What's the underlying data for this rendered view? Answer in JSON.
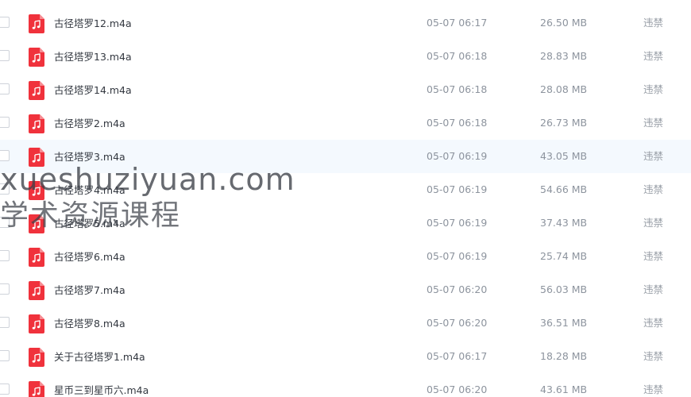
{
  "file_list": {
    "icon": "music-file-icon",
    "icon_color": "#f0323c",
    "hover_background": "#f4f9fe",
    "rows": [
      {
        "name": "古径塔罗12.m4a",
        "time": "05-07 06:17",
        "size": "26.50 MB",
        "status": "违禁"
      },
      {
        "name": "古径塔罗13.m4a",
        "time": "05-07 06:18",
        "size": "28.83 MB",
        "status": "违禁"
      },
      {
        "name": "古径塔罗14.m4a",
        "time": "05-07 06:18",
        "size": "28.08 MB",
        "status": "违禁"
      },
      {
        "name": "古径塔罗2.m4a",
        "time": "05-07 06:18",
        "size": "26.73 MB",
        "status": "违禁"
      },
      {
        "name": "古径塔罗3.m4a",
        "time": "05-07 06:19",
        "size": "43.05 MB",
        "status": "违禁"
      },
      {
        "name": "古径塔罗4.m4a",
        "time": "05-07 06:19",
        "size": "54.66 MB",
        "status": "违禁"
      },
      {
        "name": "古径塔罗5.m4a",
        "time": "05-07 06:19",
        "size": "37.43 MB",
        "status": "违禁"
      },
      {
        "name": "古径塔罗6.m4a",
        "time": "05-07 06:19",
        "size": "25.74 MB",
        "status": "违禁"
      },
      {
        "name": "古径塔罗7.m4a",
        "time": "05-07 06:20",
        "size": "56.03 MB",
        "status": "违禁"
      },
      {
        "name": "古径塔罗8.m4a",
        "time": "05-07 06:20",
        "size": "36.51 MB",
        "status": "违禁"
      },
      {
        "name": "关于古径塔罗1.m4a",
        "time": "05-07 06:17",
        "size": "18.28 MB",
        "status": "违禁"
      },
      {
        "name": "星币三到星币六.m4a",
        "time": "05-07 06:20",
        "size": "43.61 MB",
        "status": "违禁"
      }
    ]
  },
  "watermark": {
    "line1": "xueshuziyuan.com",
    "line2": "学术资源课程"
  }
}
